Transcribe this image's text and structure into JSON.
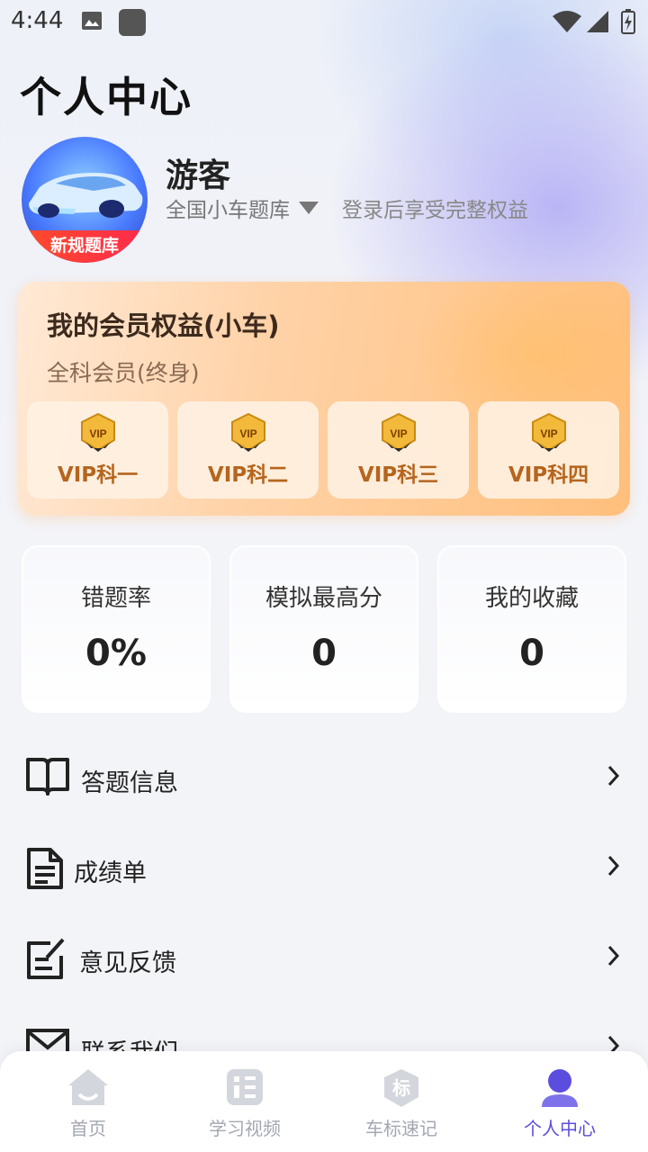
{
  "status_bar": {
    "time": "4:44"
  },
  "page": {
    "title": "个人中心"
  },
  "profile": {
    "name": "游客",
    "bank": "全国小车题库",
    "login_hint": "登录后享受完整权益",
    "avatar_ribbon": "新规题库"
  },
  "vip": {
    "title": "我的会员权益(小车)",
    "subtitle": "全科会员(终身)",
    "badge_text": "VIP",
    "items": [
      {
        "label": "VIP科一"
      },
      {
        "label": "VIP科二"
      },
      {
        "label": "VIP科三"
      },
      {
        "label": "VIP科四"
      }
    ]
  },
  "stats": [
    {
      "label": "错题率",
      "value": "0%"
    },
    {
      "label": "模拟最高分",
      "value": "0"
    },
    {
      "label": "我的收藏",
      "value": "0"
    }
  ],
  "menu": [
    {
      "label": "答题信息",
      "icon": "book-icon"
    },
    {
      "label": "成绩单",
      "icon": "document-icon"
    },
    {
      "label": "意见反馈",
      "icon": "edit-icon"
    },
    {
      "label": "联系我们",
      "icon": "mail-icon"
    }
  ],
  "tabs": [
    {
      "label": "首页",
      "icon": "home-icon",
      "active": false
    },
    {
      "label": "学习视频",
      "icon": "video-icon",
      "active": false
    },
    {
      "label": "车标速记",
      "icon": "badge-icon",
      "active": false
    },
    {
      "label": "个人中心",
      "icon": "person-icon",
      "active": true
    }
  ],
  "tab_badge_char": "标",
  "colors": {
    "accent": "#5b4dde",
    "vip_text": "#b5651d",
    "inactive": "#a3a7b2"
  }
}
